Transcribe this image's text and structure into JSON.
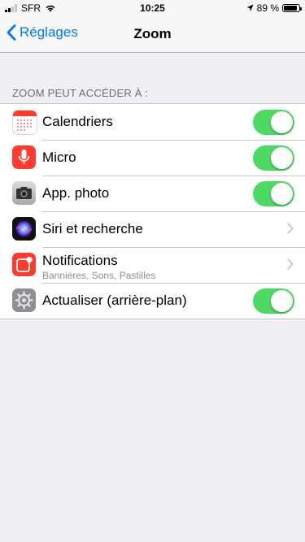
{
  "status_bar": {
    "carrier": "SFR",
    "time": "10:25",
    "battery_percent": "89 %",
    "battery_level": 0.89,
    "signal_bars_filled": 2
  },
  "nav": {
    "back_label": "Réglages",
    "title": "Zoom"
  },
  "section": {
    "header": "ZOOM PEUT ACCÉDER À :"
  },
  "rows": [
    {
      "label": "Calendriers",
      "icon": "calendar-icon",
      "control": "toggle",
      "on": true
    },
    {
      "label": "Micro",
      "icon": "microphone-icon",
      "control": "toggle",
      "on": true
    },
    {
      "label": "App. photo",
      "icon": "camera-icon",
      "control": "toggle",
      "on": true
    },
    {
      "label": "Siri et recherche",
      "icon": "siri-icon",
      "control": "chevron"
    },
    {
      "label": "Notifications",
      "sublabel": "Bannières, Sons, Pastilles",
      "icon": "notifications-icon",
      "control": "chevron"
    },
    {
      "label": "Actualiser (arrière-plan)",
      "icon": "gear-icon",
      "control": "toggle",
      "on": true
    }
  ],
  "colors": {
    "accent": "#007aff",
    "toggle_on": "#4cd964",
    "background": "#efeff4"
  }
}
